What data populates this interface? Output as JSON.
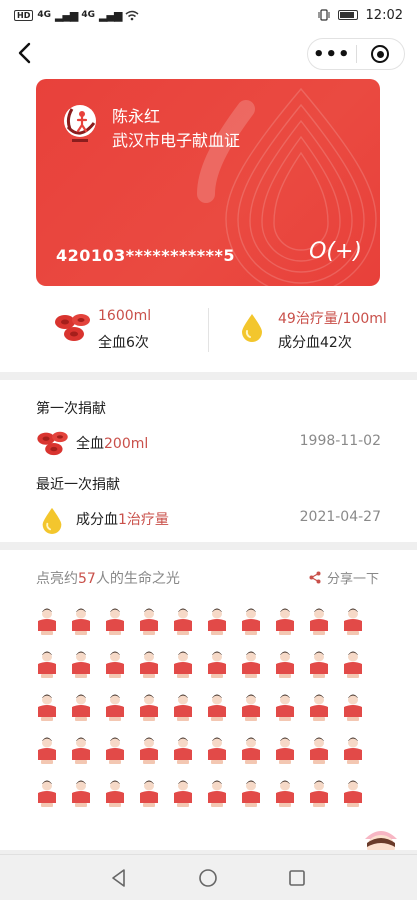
{
  "status_bar": {
    "hd": "HD",
    "net1": "4G",
    "net2": "4G",
    "time": "12:02",
    "icons": [
      "signal-icon",
      "wifi-icon",
      "vibrate-icon",
      "battery-icon"
    ]
  },
  "nav": {
    "back_icon": "back-arrow-icon",
    "more_label": "•••",
    "close_icon": "target-close-icon"
  },
  "card": {
    "name": "陈永红",
    "title": "武汉市电子献血证",
    "id_number": "420103***********5",
    "blood_type": "O(+)",
    "colors": {
      "card_red": "#e8413b",
      "accent": "#c9504a"
    }
  },
  "stats": {
    "whole_blood_value": "1600ml",
    "whole_blood_label": "全血6次",
    "component_value": "49治疗量/100ml",
    "component_label": "成分血42次"
  },
  "donations": {
    "first_title": "第一次捐献",
    "first_type": "全血",
    "first_amount": "200ml",
    "first_date": "1998-11-02",
    "recent_title": "最近一次捐献",
    "recent_type": "成分血",
    "recent_amount": "1治疗量",
    "recent_date": "2021-04-27"
  },
  "light": {
    "prefix": "点亮约",
    "count": "57",
    "suffix": "人的生命之光",
    "share_label": "分享一下",
    "share_icon": "share-icon"
  },
  "system_nav": {
    "icons": [
      "triangle-back-icon",
      "circle-home-icon",
      "square-recent-icon"
    ]
  }
}
